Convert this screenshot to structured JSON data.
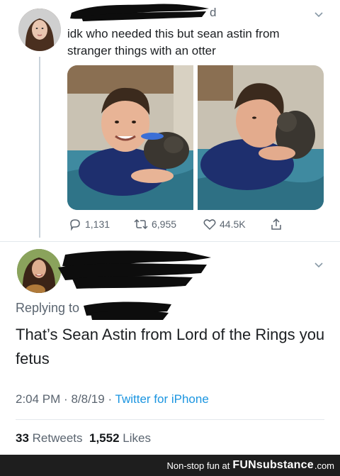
{
  "tweet1": {
    "handle_fragment": "d",
    "text": "idk who needed this but sean astin from stranger things with an otter",
    "actions": {
      "replies": "1,131",
      "retweets": "6,955",
      "likes": "44.5K"
    }
  },
  "tweet2": {
    "replying_label": "Replying to",
    "text": "That’s Sean Astin from Lord of the Rings you fetus",
    "time": "2:04 PM",
    "date": "8/8/19",
    "source": "Twitter for iPhone",
    "retweets_count": "33",
    "retweets_label": "Retweets",
    "likes_count": "1,552",
    "likes_label": "Likes"
  },
  "footer": {
    "tagline": "Non-stop fun at",
    "brand": "FUNsubstance",
    "tld": ".com"
  },
  "colors": {
    "link_blue": "#1b95e0",
    "muted_gray": "#5b6570",
    "footer_bg": "#1e1e1e"
  },
  "icons": [
    "chevron-down-icon",
    "reply-icon",
    "retweet-icon",
    "like-icon",
    "share-icon"
  ]
}
